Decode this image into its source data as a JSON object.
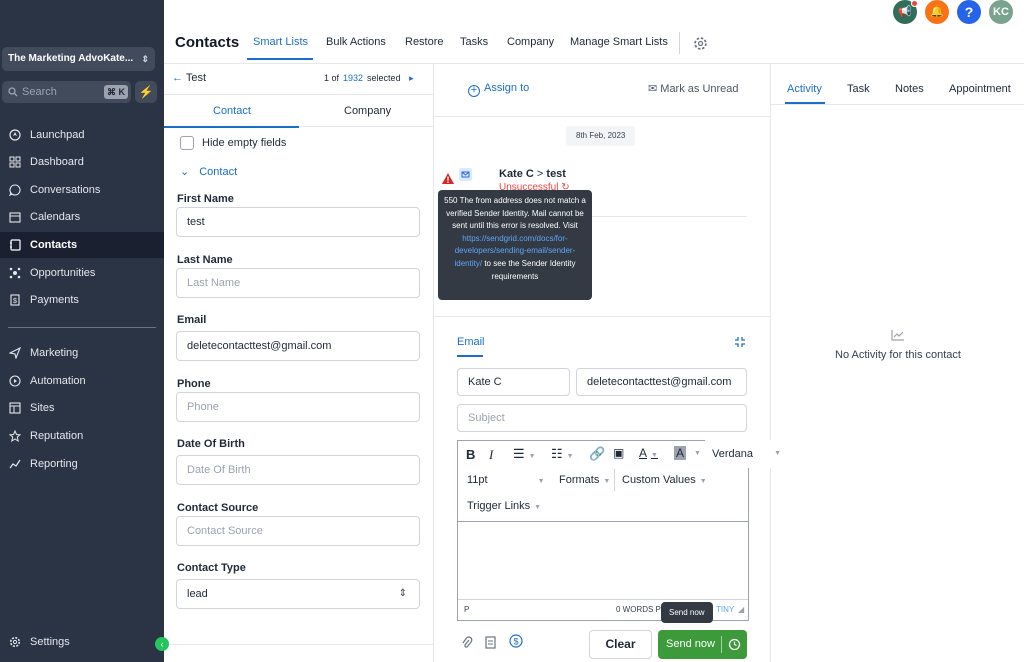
{
  "sidebar": {
    "account": "The Marketing AdvoKate...",
    "search_placeholder": "Search",
    "search_shortcut": "⌘ K",
    "items": [
      {
        "label": "Launchpad",
        "icon": "rocket-icon"
      },
      {
        "label": "Dashboard",
        "icon": "dashboard-icon"
      },
      {
        "label": "Conversations",
        "icon": "chat-icon"
      },
      {
        "label": "Calendars",
        "icon": "calendar-icon"
      },
      {
        "label": "Contacts",
        "icon": "contacts-icon",
        "active": true
      },
      {
        "label": "Opportunities",
        "icon": "opportunities-icon"
      },
      {
        "label": "Payments",
        "icon": "payments-icon"
      },
      {
        "label": "Marketing",
        "icon": "send-icon"
      },
      {
        "label": "Automation",
        "icon": "automation-icon"
      },
      {
        "label": "Sites",
        "icon": "sites-icon"
      },
      {
        "label": "Reputation",
        "icon": "star-icon"
      },
      {
        "label": "Reporting",
        "icon": "reporting-icon"
      }
    ],
    "settings": "Settings"
  },
  "header": {
    "title": "Contacts",
    "tabs": [
      "Smart Lists",
      "Bulk Actions",
      "Restore",
      "Tasks",
      "Company",
      "Manage Smart Lists"
    ],
    "active_tab": "Smart Lists",
    "avatar": "KC",
    "help": "?"
  },
  "contact_panel": {
    "back_label": "Test",
    "pager_of": "1 of",
    "pager_total": "1932",
    "pager_selected": "selected",
    "tabs": [
      "Contact",
      "Company"
    ],
    "hide_empty": "Hide empty fields",
    "section": "Contact",
    "fields": [
      {
        "label": "First Name",
        "value": "test",
        "placeholder": ""
      },
      {
        "label": "Last Name",
        "value": "",
        "placeholder": "Last Name"
      },
      {
        "label": "Email",
        "value": "deletecontacttest@gmail.com",
        "placeholder": ""
      },
      {
        "label": "Phone",
        "value": "",
        "placeholder": "Phone"
      },
      {
        "label": "Date Of Birth",
        "value": "",
        "placeholder": "Date Of Birth"
      },
      {
        "label": "Contact Source",
        "value": "",
        "placeholder": "Contact Source"
      },
      {
        "label": "Contact Type",
        "value": "lead",
        "placeholder": ""
      }
    ]
  },
  "conversation": {
    "assign_to": "Assign to",
    "mark_unread": "Mark as Unread",
    "date": "8th Feb, 2023",
    "sender": "Kate C",
    "recipient": "test",
    "status": "Unsuccessful",
    "tooltip": "550 The from address does not match a verified Sender Identity. Mail cannot be sent until this error is resolved. Visit",
    "tooltip_link": "https://sendgrid.com/docs/for-developers/sending-email/sender-identity/",
    "tooltip_tail": "to see the Sender Identity requirements"
  },
  "composer": {
    "tab": "Email",
    "from_name": "Kate C",
    "to_email": "deletecontacttest@gmail.com",
    "subject_placeholder": "Subject",
    "font": "Verdana",
    "font_size": "11pt",
    "formats": "Formats",
    "custom_values": "Custom Values",
    "trigger_links": "Trigger Links",
    "status_path": "P",
    "word_count": "0 WORDS P",
    "powered": "TINY",
    "clear": "Clear",
    "send": "Send now",
    "send_tooltip": "Send now"
  },
  "activity": {
    "tabs": [
      "Activity",
      "Task",
      "Notes",
      "Appointment"
    ],
    "active_tab": "Activity",
    "empty": "No Activity for this contact"
  },
  "colors": {
    "accent": "#1a6fc8",
    "sidebar": "#2b3445",
    "send": "#3c9a3a",
    "error": "#ef4444"
  }
}
